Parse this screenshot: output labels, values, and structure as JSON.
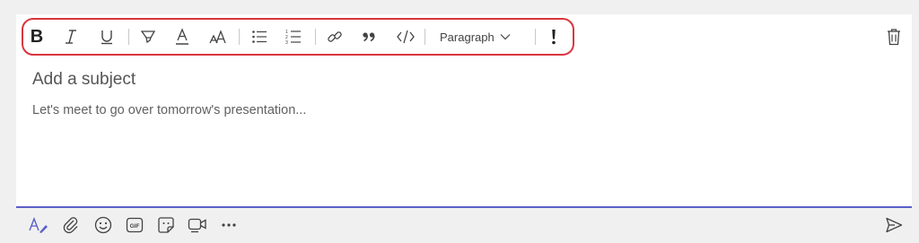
{
  "toolbar": {
    "icons": [
      "bold-icon",
      "italic-icon",
      "underline-icon",
      "highlight-icon",
      "font-color-icon",
      "font-size-icon",
      "bulleted-list-icon",
      "numbered-list-icon",
      "link-icon",
      "quote-icon",
      "code-icon",
      "important-icon"
    ],
    "paragraph_label": "Paragraph"
  },
  "compose": {
    "subject_placeholder": "Add a subject",
    "body_text": "Let's meet to go over tomorrow's presentation..."
  },
  "bottom_bar": {
    "icons": [
      "format-icon",
      "attach-icon",
      "emoji-icon",
      "gif-icon",
      "sticker-icon",
      "meet-now-icon",
      "more-options-icon",
      "send-icon"
    ]
  },
  "colors": {
    "highlight_outline": "#d9363e",
    "accent": "#5b5fc7",
    "icon": "#424242"
  }
}
